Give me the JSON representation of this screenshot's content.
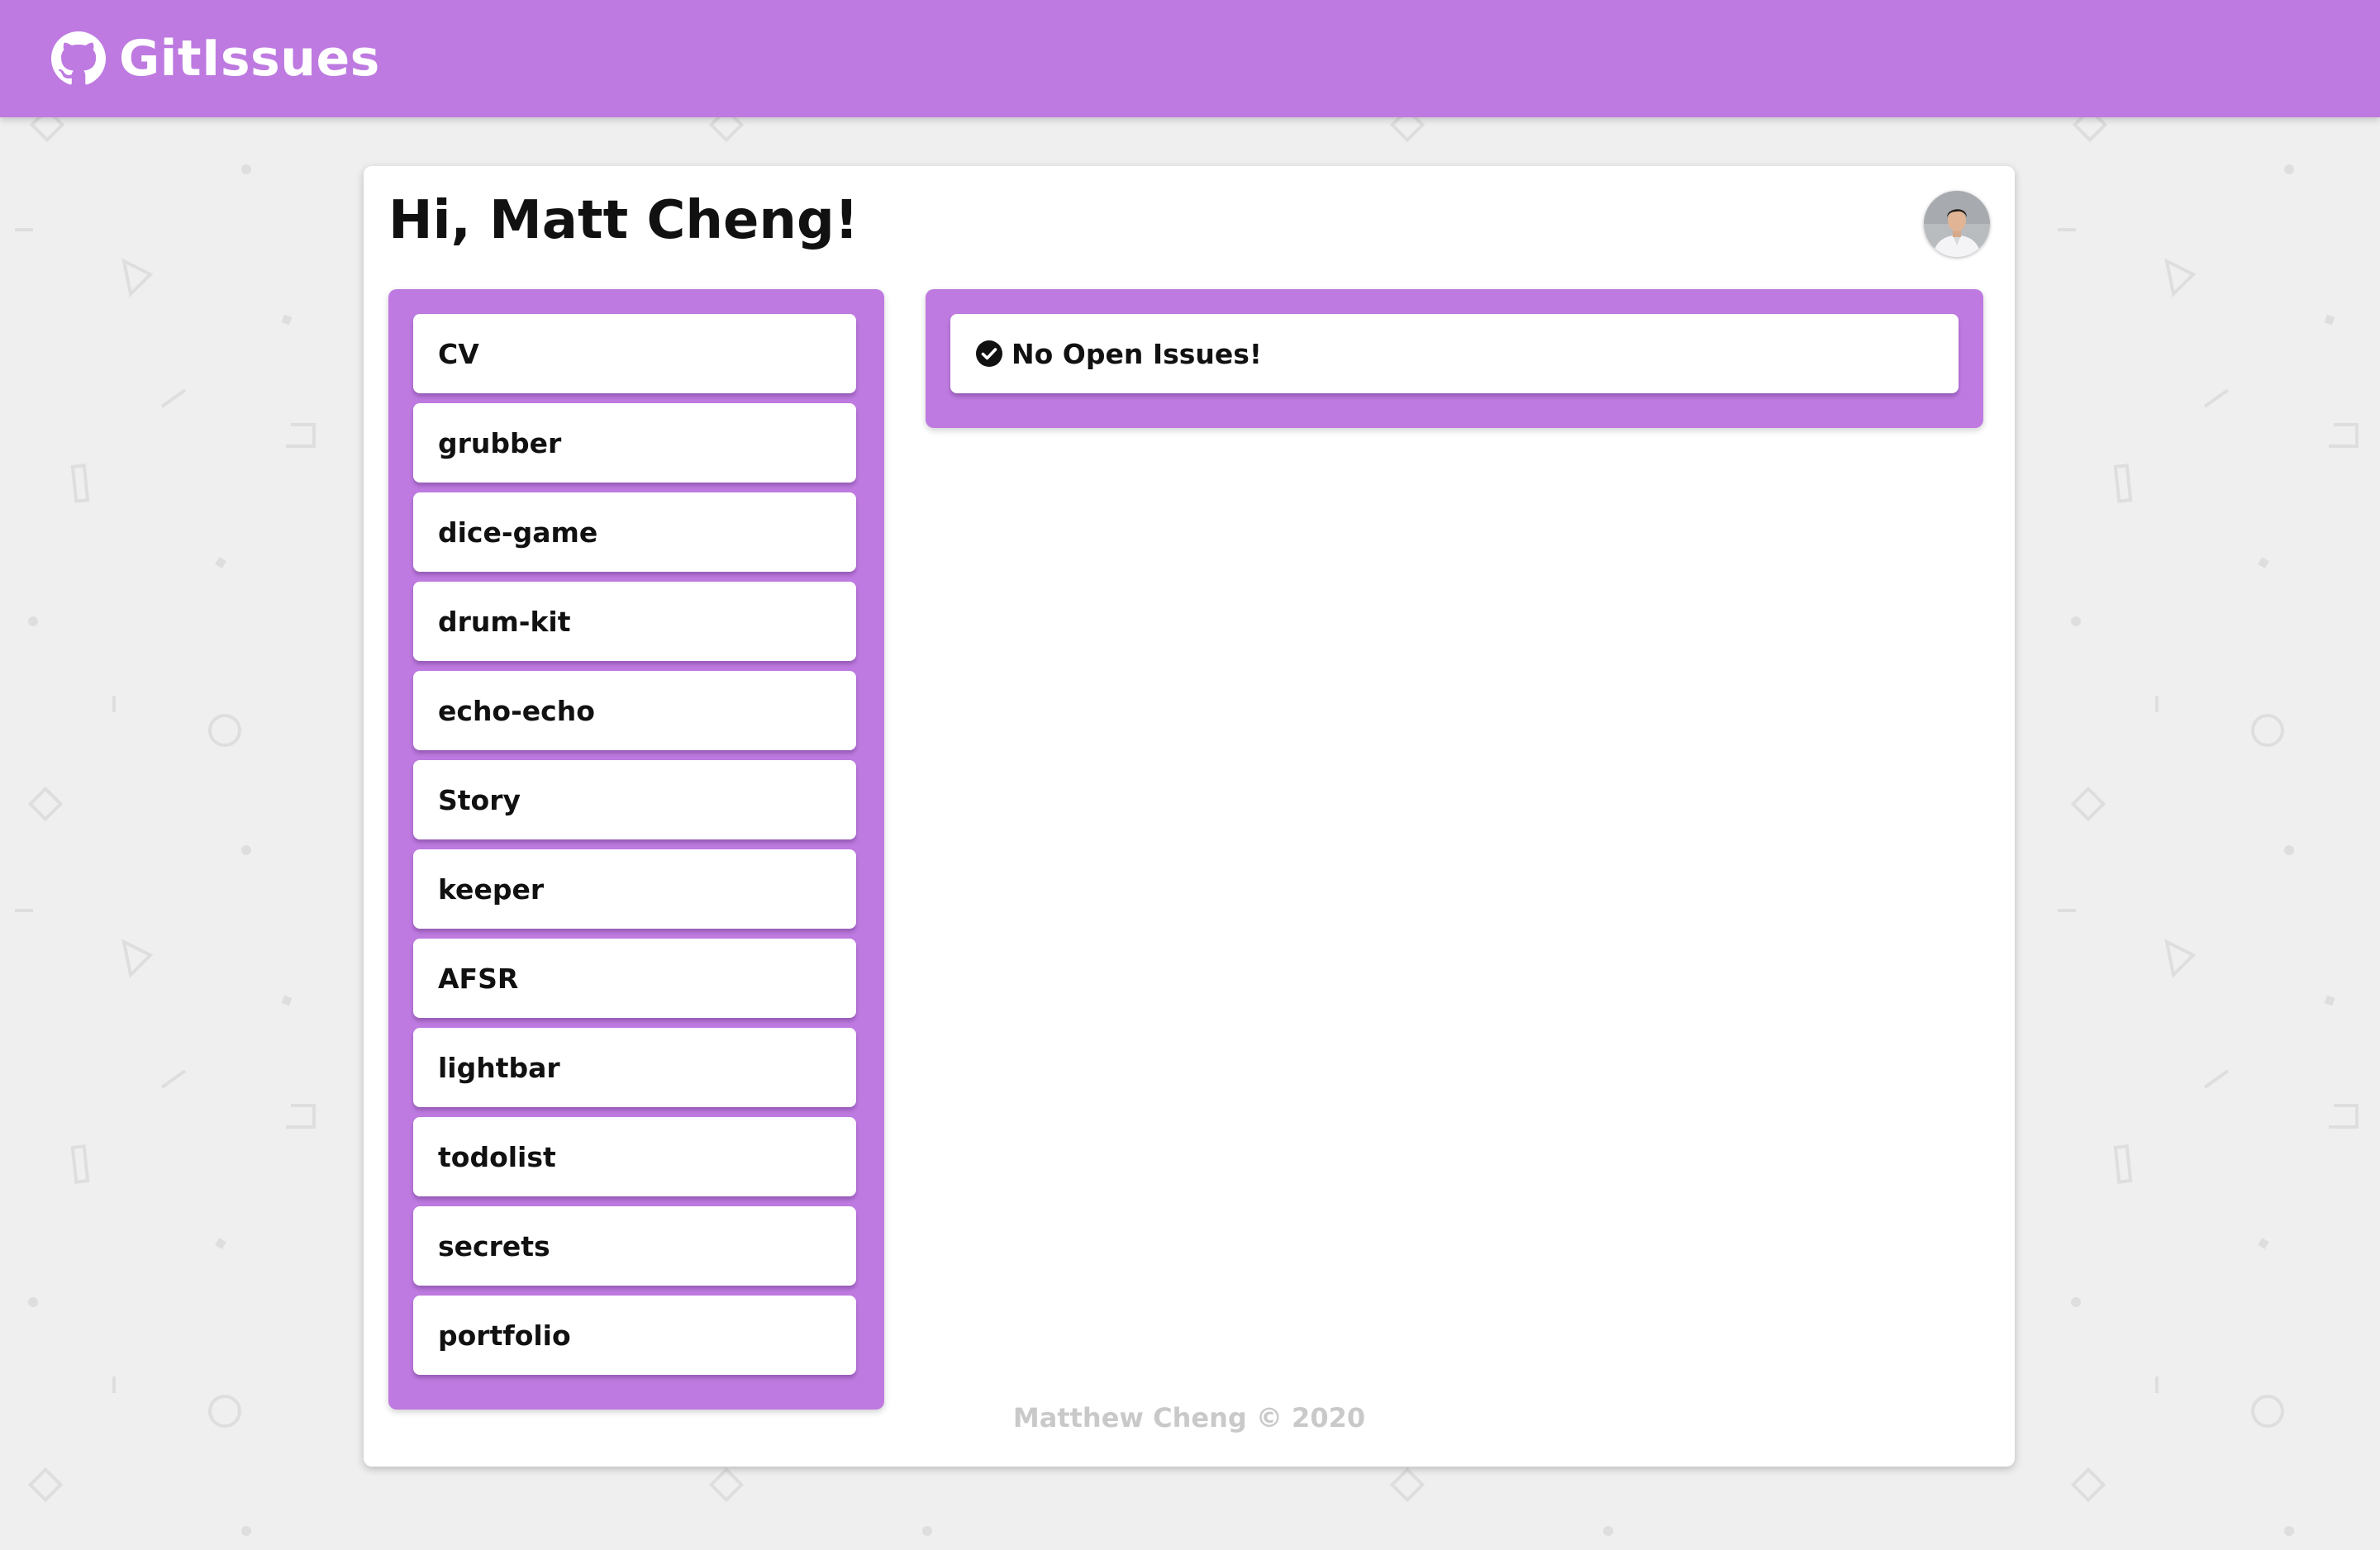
{
  "header": {
    "brand": "GitIssues",
    "brand_icon": "github-icon",
    "color": "#be7ae0"
  },
  "main": {
    "greeting": "Hi, Matt Cheng!",
    "avatar_icon": "user-avatar"
  },
  "repos": [
    "CV",
    "grubber",
    "dice-game",
    "drum-kit",
    "echo-echo",
    "Story",
    "keeper",
    "AFSR",
    "lightbar",
    "todolist",
    "secrets",
    "portfolio"
  ],
  "issues": {
    "status_icon": "check-circle-icon",
    "message": "No Open Issues!"
  },
  "footer": {
    "text": "Matthew Cheng © 2020"
  }
}
